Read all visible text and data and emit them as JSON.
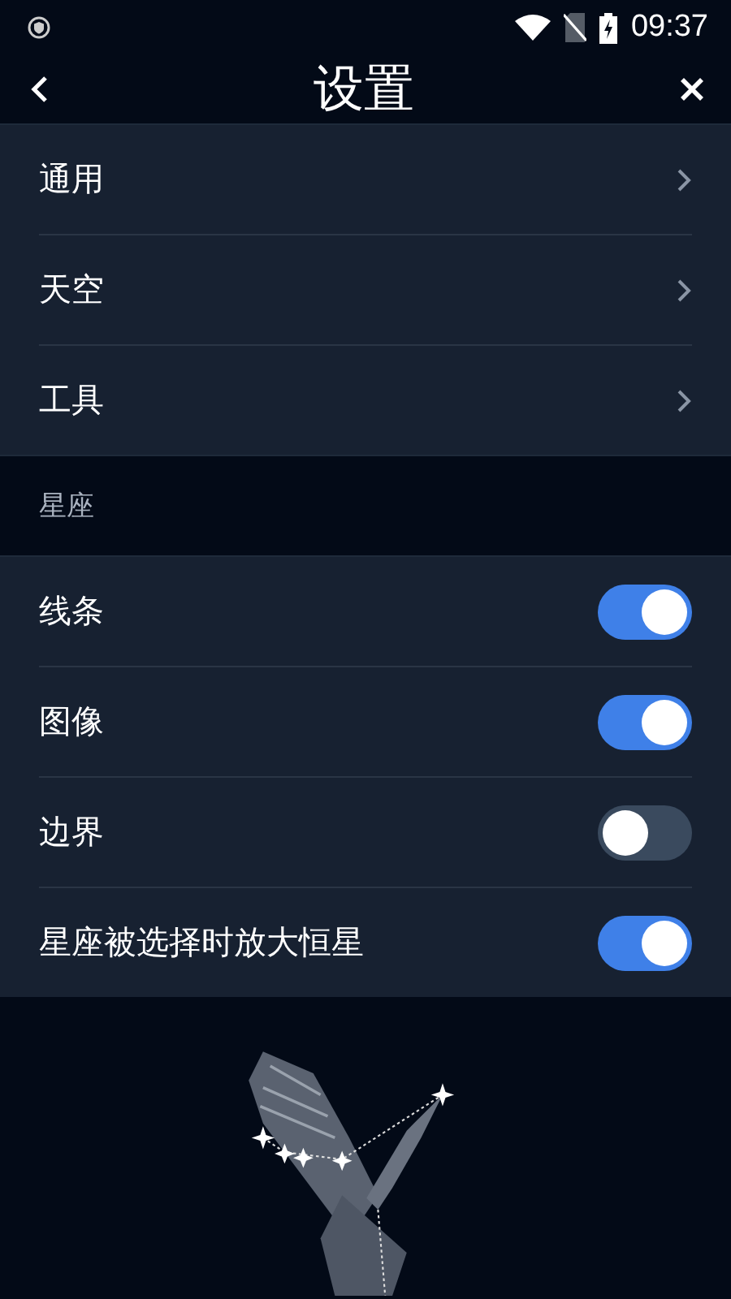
{
  "status_bar": {
    "time": "09:37"
  },
  "header": {
    "title": "设置"
  },
  "menu_items": [
    {
      "label": "通用"
    },
    {
      "label": "天空"
    },
    {
      "label": "工具"
    }
  ],
  "constellation_section": {
    "heading": "星座",
    "toggles": [
      {
        "label": "线条",
        "on": true
      },
      {
        "label": "图像",
        "on": true
      },
      {
        "label": "边界",
        "on": false
      },
      {
        "label": "星座被选择时放大恒星",
        "on": true
      }
    ]
  }
}
